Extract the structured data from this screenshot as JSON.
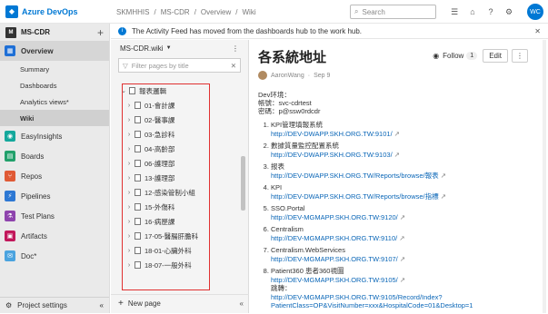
{
  "topbar": {
    "brand": "Azure DevOps",
    "breadcrumbs": [
      "SKMHHIS",
      "/",
      "MS-CDR",
      "/",
      "Overview",
      "/",
      "Wiki"
    ],
    "search_placeholder": "Search",
    "avatar_initials": "WC"
  },
  "sidebar": {
    "project": "MS-CDR",
    "project_initial": "M",
    "items": [
      {
        "label": "Overview",
        "icon": "overview-icon",
        "color": "#1e6fd6",
        "selected": true
      },
      {
        "label": "Summary",
        "sub": true
      },
      {
        "label": "Dashboards",
        "sub": true
      },
      {
        "label": "Analytics views*",
        "sub": true
      },
      {
        "label": "Wiki",
        "sub": true,
        "selected": true
      },
      {
        "label": "EasyInsights",
        "icon": "insights-icon",
        "color": "#14a89c"
      },
      {
        "label": "Boards",
        "icon": "boards-icon",
        "color": "#22a06b"
      },
      {
        "label": "Repos",
        "icon": "repos-icon",
        "color": "#e05a35"
      },
      {
        "label": "Pipelines",
        "icon": "pipelines-icon",
        "color": "#2d78d3"
      },
      {
        "label": "Test Plans",
        "icon": "test-plans-icon",
        "color": "#8e44ad"
      },
      {
        "label": "Artifacts",
        "icon": "artifacts-icon",
        "color": "#c2185b"
      },
      {
        "label": "Doc*",
        "icon": "doc-icon",
        "color": "#4aa3df"
      }
    ],
    "settings": "Project settings"
  },
  "banner": {
    "text": "The Activity Feed has moved from the dashboards hub to the work hub."
  },
  "wiki": {
    "name": "MS-CDR.wiki",
    "filter_placeholder": "Filter pages by title",
    "tree": [
      {
        "label": "報表邏輯",
        "expanded": true,
        "level": 0
      },
      {
        "label": "01-會計課",
        "level": 1
      },
      {
        "label": "02-醫事課",
        "level": 1
      },
      {
        "label": "03-急診科",
        "level": 1
      },
      {
        "label": "04-高齡部",
        "level": 1
      },
      {
        "label": "06-護理部",
        "level": 1
      },
      {
        "label": "13-護理部",
        "level": 1
      },
      {
        "label": "12-感染管制小組",
        "level": 1
      },
      {
        "label": "15-外傷科",
        "level": 1
      },
      {
        "label": "16-病歷課",
        "level": 1
      },
      {
        "label": "17-05-醫腸肝膽科",
        "level": 1
      },
      {
        "label": "18-01-心臟外科",
        "level": 1
      },
      {
        "label": "18-07-一般外科",
        "level": 1
      }
    ],
    "new_page": "New page"
  },
  "page": {
    "title": "各系統地址",
    "author": "AaronWang",
    "date": "Sep 9",
    "follow_label": "Follow",
    "follow_count": "1",
    "edit_label": "Edit",
    "env_lines": [
      "Dev环境：",
      "帳號：svc-cdrtest",
      "密碼：p@ssw0rdcdr"
    ],
    "items": [
      {
        "title": "KPI管理填報系統",
        "url": "http://DEV-DWAPP.SKH.ORG.TW:9101/"
      },
      {
        "title": "數據質量監控配置系統",
        "url": "http://DEV-DWAPP.SKH.ORG.TW:9103/"
      },
      {
        "title": "报表",
        "url": "http://DEV-DWAPP.SKH.ORG.TW/Reports/browse/報表"
      },
      {
        "title": "KPI",
        "url": "http://DEV-DWAPP.SKH.ORG.TW/Reports/browse/指標"
      },
      {
        "title": "SSO.Portal",
        "url": "http://DEV-MGMAPP.SKH.ORG.TW:9120/"
      },
      {
        "title": "Centralism",
        "url": "http://DEV-MGMAPP.SKH.ORG.TW:9110/"
      },
      {
        "title": "Centralism.WebServices",
        "url": "http://DEV-MGMAPP.SKH.ORG.TW:9107/"
      },
      {
        "title": "Patient360 患者360視圖",
        "url": "http://DEV-MGMAPP.SKH.ORG.TW:9105/",
        "extra": "跳轉：",
        "extra_url": "http://DEV-MGMAPP.SKH.ORG.TW:9105/Record/Index?PatientClass=OP&VisitNumber=xxx&HospitalCode=01&Desktop=1"
      }
    ]
  }
}
